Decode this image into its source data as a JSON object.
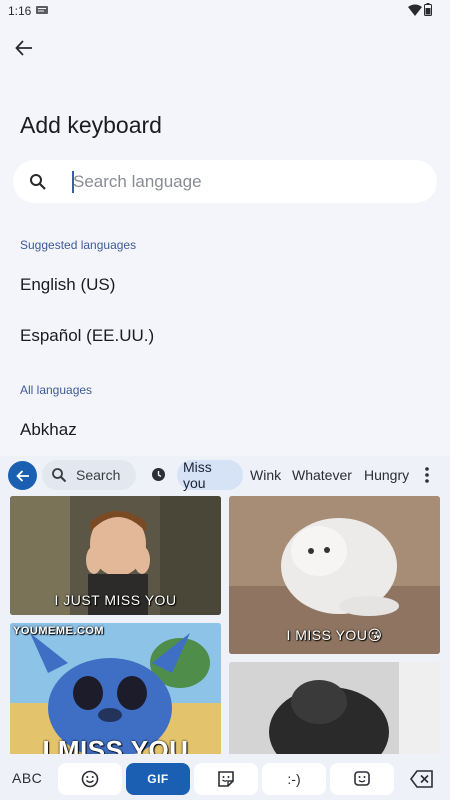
{
  "status_bar": {
    "time": "1:16"
  },
  "header": {
    "title": "Add keyboard"
  },
  "search": {
    "placeholder": "Search language",
    "value": ""
  },
  "suggested": {
    "header": "Suggested languages",
    "items": [
      "English (US)",
      "Español (EE.UU.)"
    ]
  },
  "all_languages": {
    "header": "All languages",
    "items": [
      "Abkhaz"
    ]
  },
  "keyboard": {
    "search_label": "Search",
    "categories": [
      "Miss you",
      "Wink",
      "Whatever",
      "Hungry"
    ],
    "active_category": "Miss you",
    "gifs": [
      {
        "caption": "I JUST MISS YOU"
      },
      {
        "caption": "I MISS YOU😘"
      },
      {
        "caption": "I MISS YOU",
        "watermark": "YOUMEME.COM"
      },
      {
        "caption": ""
      }
    ],
    "bottom": {
      "abc_label": "ABC",
      "gif_label": "GIF",
      "emoticon_label": ":-)"
    },
    "accent_color": "#1a5fb2"
  }
}
